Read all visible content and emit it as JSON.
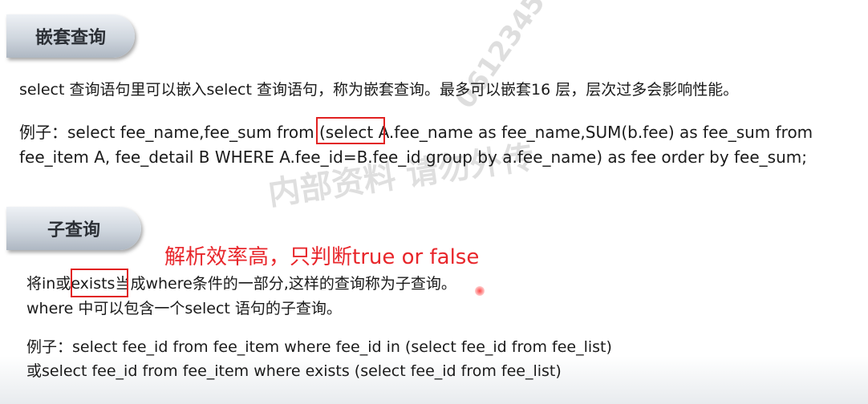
{
  "section1": {
    "title": "嵌套查询",
    "desc": "select 查询语句里可以嵌入select 查询语句，称为嵌套查询。最多可以嵌套16 层，层次过多会影响性能。",
    "example_line1": "例子：select fee_name,fee_sum from (select A.fee_name as fee_name,SUM(b.fee) as fee_sum from",
    "example_line2": "fee_item A, fee_detail B WHERE A.fee_id=B.fee_id group by a.fee_name) as fee order by fee_sum;"
  },
  "section2": {
    "title": "子查询",
    "note": "解析效率高，只判断true or false",
    "desc_line1": "将in或exists当成where条件的一部分,这样的查询称为子查询。",
    "desc_line2": "where 中可以包含一个select 语句的子查询。",
    "example_line1": "例子：select fee_id from fee_item where fee_id in (select fee_id from fee_list)",
    "example_line2": "或select fee_id from fee_item where exists (select fee_id from fee_list)"
  },
  "colors": {
    "annotation": "#e8262b",
    "text": "#1a1a1a"
  }
}
